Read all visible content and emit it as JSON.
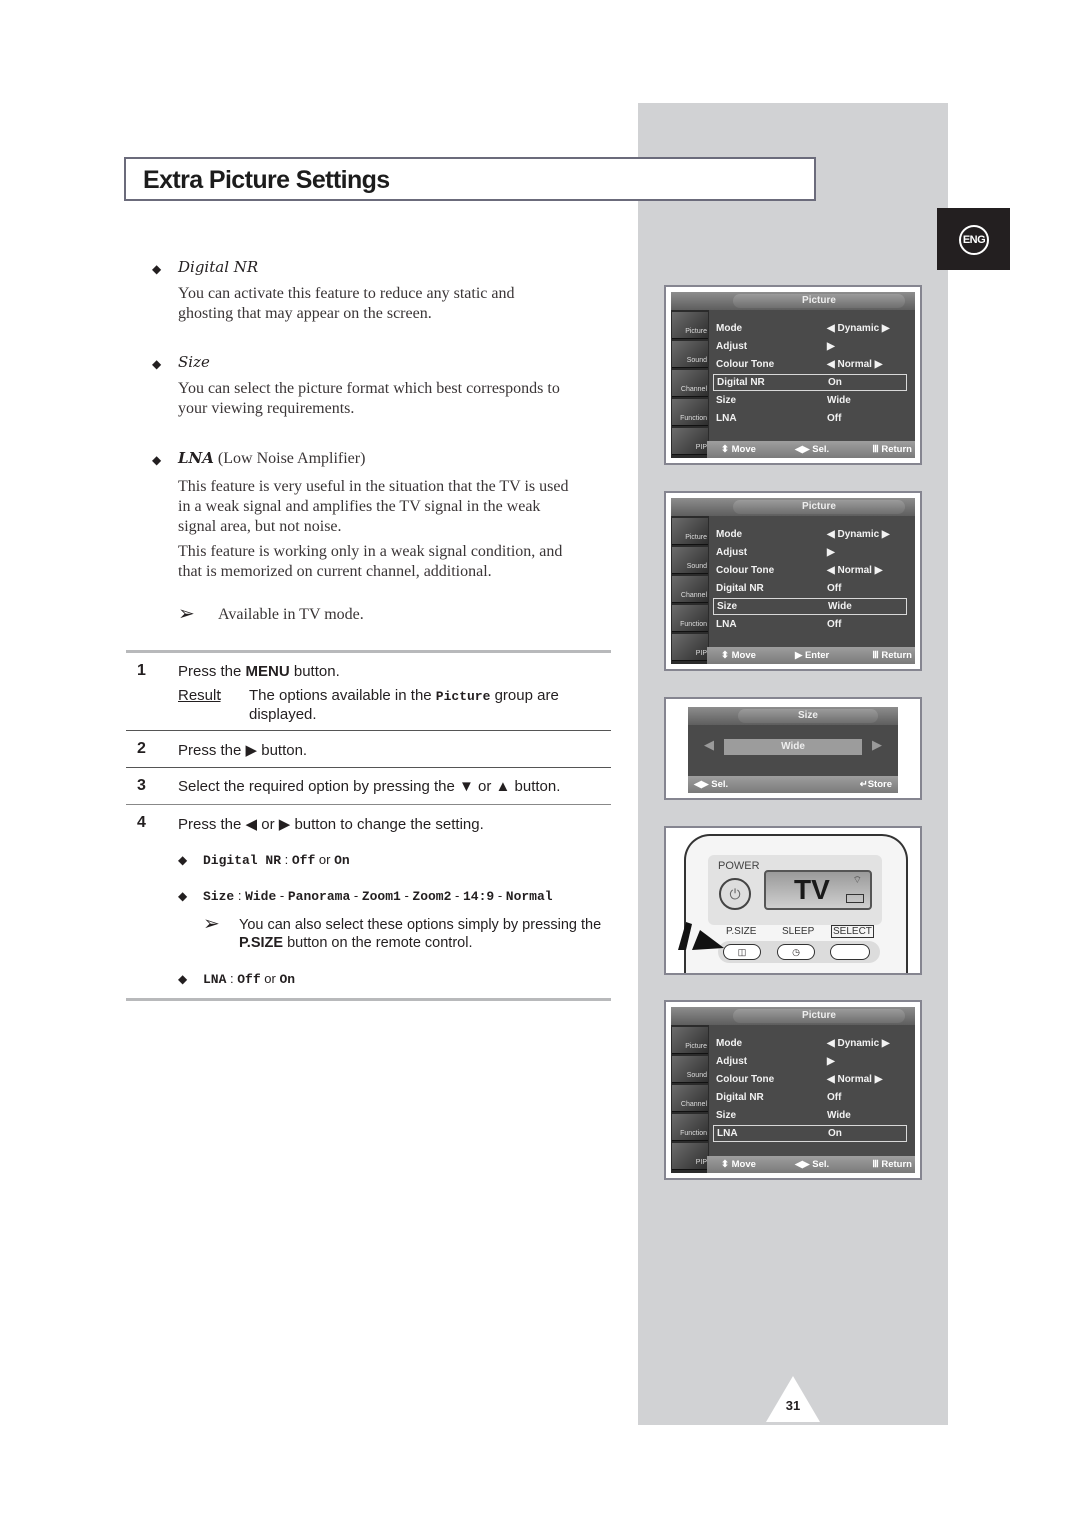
{
  "page": {
    "title": "Extra Picture Settings",
    "language_badge": "ENG",
    "page_number": "31"
  },
  "features": [
    {
      "name": "Digital NR",
      "name_suffix": "",
      "paragraphs": [
        "You can activate this feature to reduce any static and",
        "ghosting that may appear on the screen."
      ]
    },
    {
      "name": "Size",
      "name_suffix": "",
      "paragraphs": [
        "You can select the picture format which best corresponds to",
        "your viewing requirements."
      ]
    },
    {
      "name": "LNA",
      "name_suffix": " (Low Noise Amplifier)",
      "paragraphs": [
        "This feature is very useful in the situation that the TV is used",
        "in a weak signal and amplifies the TV signal in the weak",
        "signal area, but not noise.",
        "This feature is working only in a weak signal condition, and",
        "that is memorized on current channel, additional."
      ],
      "note": "Available in TV mode."
    }
  ],
  "steps": [
    {
      "number": "1",
      "text_pre": "Press the ",
      "text_bold": "MENU",
      "text_post": " button.",
      "result_label": "Result",
      "result_pre": "The options available in the ",
      "result_mono": "Picture",
      "result_post": " group are",
      "result_line2": "displayed."
    },
    {
      "number": "2",
      "text": "Press the ▶ button."
    },
    {
      "number": "3",
      "text": "Select the required option by pressing the ▼ or ▲ button."
    },
    {
      "number": "4",
      "text": "Press the ◀ or ▶ button to change the setting."
    }
  ],
  "options": [
    {
      "name": "Digital NR",
      "sep": " : ",
      "values": [
        "Off",
        " or ",
        "On"
      ]
    },
    {
      "name": "Size",
      "sep": " :  ",
      "values": [
        "Wide",
        " - ",
        "Panorama",
        " - ",
        "Zoom1",
        " - ",
        "Zoom2",
        " - ",
        "14:9",
        " - ",
        "Normal"
      ]
    },
    {
      "name": "LNA",
      "sep": " : ",
      "values": [
        "Off",
        " or ",
        "On"
      ]
    }
  ],
  "size_note": {
    "line1": "You can also select these options simply by pressing the",
    "bold": "P.SIZE",
    "line2_post": " button on the remote control."
  },
  "osd_side_icons": [
    "Picture",
    "Sound",
    "Channel",
    "Function",
    "PIP"
  ],
  "osd_screens": [
    {
      "title": "Picture",
      "selected": 3,
      "rows": [
        {
          "label": "Mode",
          "value": "◀  Dynamic ▶"
        },
        {
          "label": "Adjust",
          "value": "▶"
        },
        {
          "label": "Colour Tone",
          "value": "◀  Normal  ▶"
        },
        {
          "label": "Digital NR",
          "value": "On"
        },
        {
          "label": "Size",
          "value": "Wide"
        },
        {
          "label": "LNA",
          "value": "Off"
        }
      ],
      "footer": {
        "move": "⬍ Move",
        "action": "◀▶ Sel.",
        "return": "Ⅲ Return"
      }
    },
    {
      "title": "Picture",
      "selected": 4,
      "rows": [
        {
          "label": "Mode",
          "value": "◀  Dynamic ▶"
        },
        {
          "label": "Adjust",
          "value": "▶"
        },
        {
          "label": "Colour Tone",
          "value": "◀  Normal  ▶"
        },
        {
          "label": "Digital NR",
          "value": "Off"
        },
        {
          "label": "Size",
          "value": "Wide"
        },
        {
          "label": "LNA",
          "value": "Off"
        }
      ],
      "footer": {
        "move": "⬍ Move",
        "action": "▶ Enter",
        "return": "Ⅲ Return"
      }
    },
    {
      "title": "Picture",
      "selected": 5,
      "rows": [
        {
          "label": "Mode",
          "value": "◀  Dynamic ▶"
        },
        {
          "label": "Adjust",
          "value": "▶"
        },
        {
          "label": "Colour Tone",
          "value": "◀  Normal  ▶"
        },
        {
          "label": "Digital NR",
          "value": "Off"
        },
        {
          "label": "Size",
          "value": "Wide"
        },
        {
          "label": "LNA",
          "value": "On"
        }
      ],
      "footer": {
        "move": "⬍ Move",
        "action": "◀▶ Sel.",
        "return": "Ⅲ Return"
      }
    }
  ],
  "size_screen": {
    "title": "Size",
    "value": "Wide",
    "footer_sel": "◀▶ Sel.",
    "footer_store": "↵Store"
  },
  "remote": {
    "power_label": "POWER",
    "display_text": "TV",
    "psize_label": "P.SIZE",
    "sleep_label": "SLEEP",
    "select_label": "SELECT"
  }
}
